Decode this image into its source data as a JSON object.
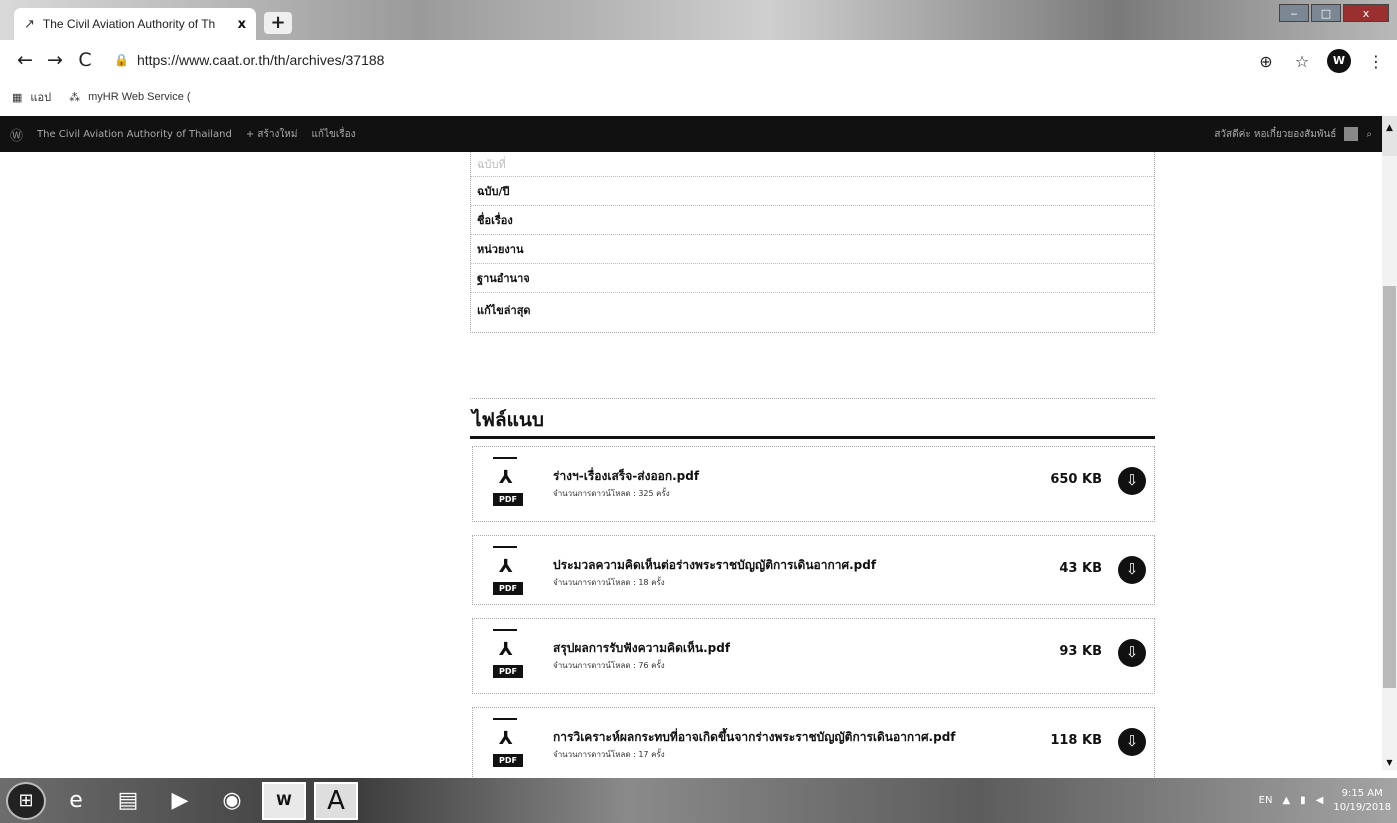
{
  "browser": {
    "tab_title": "The Civil Aviation Authority of Th",
    "tab_close": "x",
    "new_tab": "+",
    "url": "https://www.caat.or.th/th/archives/37188",
    "back": "←",
    "forward": "→",
    "reload": "C",
    "bookmarks": [
      {
        "label": "แอป"
      },
      {
        "label": "myHR Web Service ("
      }
    ]
  },
  "adminbar": {
    "site_name": "The Civil Aviation Authority of Thailand",
    "new_label": "+ สร้างใหม่",
    "edit_label": "แก้ไขเรื่อง",
    "greeting": "สวัสดีค่ะ หอเกี๋ยวยองสัมพันธ์"
  },
  "info_rows": [
    {
      "label": "ฉบับที่"
    },
    {
      "label": "ฉบับ/ปี"
    },
    {
      "label": "ชื่อเรื่อง"
    },
    {
      "label": "หน่วยงาน"
    },
    {
      "label": "ฐานอำนาจ"
    },
    {
      "label": "แก้ไขล่าสุด"
    }
  ],
  "attachments": {
    "heading": "ไฟล์แนบ",
    "files": [
      {
        "name": "ร่างฯ-เรื่องเสร็จ-ส่งออก.pdf",
        "count": "จำนวนการดาวน์โหลด : 325 ครั้ง",
        "size": "650 KB",
        "badge": "PDF"
      },
      {
        "name": "ประมวลความคิดเห็นต่อร่างพระราชบัญญัติการเดินอากาศ.pdf",
        "count": "จำนวนการดาวน์โหลด : 18 ครั้ง",
        "size": "43 KB",
        "badge": "PDF"
      },
      {
        "name": "สรุปผลการรับฟังความคิดเห็น.pdf",
        "count": "จำนวนการดาวน์โหลด : 76 ครั้ง",
        "size": "93 KB",
        "badge": "PDF"
      },
      {
        "name": "การวิเคราะห์ผลกระทบที่อาจเกิดขึ้นจากร่างพระราชบัญญัติการเดินอากาศ.pdf",
        "count": "จำนวนการดาวน์โหลด : 17 ครั้ง",
        "size": "118 KB",
        "badge": "PDF"
      }
    ]
  },
  "taskbar": {
    "lang": "EN",
    "time": "9:15 AM",
    "date": "10/19/2018",
    "word_label": "W",
    "font_label": "A"
  }
}
